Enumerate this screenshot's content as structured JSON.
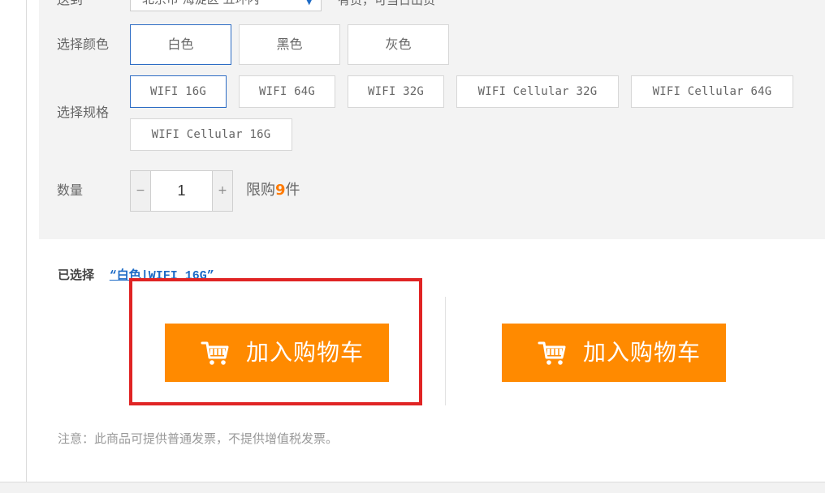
{
  "shipping": {
    "label": "送到",
    "address": "北京市 海淀区 五环内",
    "status": "有货，可当日出货"
  },
  "color": {
    "label": "选择颜色",
    "options": [
      "白色",
      "黑色",
      "灰色"
    ],
    "selected_index": 0
  },
  "spec": {
    "label": "选择规格",
    "options": [
      "WIFI 16G",
      "WIFI 64G",
      "WIFI 32G",
      "WIFI Cellular 32G",
      "WIFI Cellular 64G",
      "WIFI Cellular 16G"
    ],
    "selected_index": 0
  },
  "quantity": {
    "label": "数量",
    "minus": "−",
    "value": "1",
    "plus": "+",
    "limit_prefix": "限购",
    "limit_count": "9",
    "limit_suffix": "件"
  },
  "selection": {
    "label": "已选择",
    "value": "“白色|WIFI 16G”"
  },
  "actions": {
    "add_to_cart_primary": "加入购物车",
    "add_to_cart_secondary": "加入购物车"
  },
  "notice": "注意：此商品可提供普通发票，不提供增值税发票。",
  "colors": {
    "accent_orange": "#ff8a00",
    "selected_border": "#2c6cc4",
    "link_blue": "#1e6bc6",
    "limit_orange": "#ff7a00",
    "highlight_red": "#e02424",
    "panel_bg": "#f3f3f3"
  },
  "icons": {
    "cart": "shopping-cart-icon",
    "dropdown": "chevron-down-icon"
  }
}
